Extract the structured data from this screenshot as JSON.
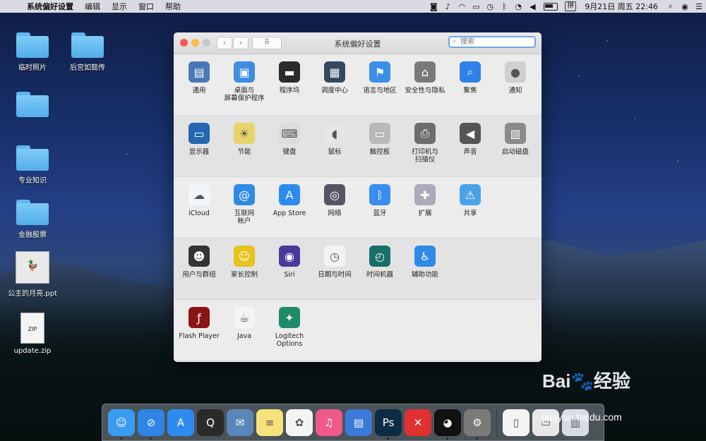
{
  "menubar": {
    "apple_icon": "apple-icon",
    "items": [
      "系统偏好设置",
      "编辑",
      "显示",
      "窗口",
      "帮助"
    ],
    "status_icons": [
      "stop-icon",
      "bell-icon",
      "airdrop-icon",
      "display-icon",
      "timemachine-icon",
      "bluetooth-icon",
      "wifi-icon",
      "volume-icon"
    ],
    "ime": "拼",
    "clock": "9月21日 周五 22:46"
  },
  "desktop": {
    "items": [
      {
        "label": "临时照片",
        "type": "folder"
      },
      {
        "label": "后宫如懿传",
        "type": "folder"
      },
      {
        "label": "",
        "type": "folder"
      },
      {
        "label": "专业知识",
        "type": "folder"
      },
      {
        "label": "金融股票",
        "type": "folder"
      },
      {
        "label": "公主的月亮.ppt",
        "type": "ppt"
      },
      {
        "label": "update.zip",
        "type": "zip",
        "badge": "ZIP"
      }
    ]
  },
  "window": {
    "title": "系统偏好设置",
    "search_placeholder": "搜索",
    "grid_glyph": "⠿",
    "back_glyph": "‹",
    "forward_glyph": "›",
    "sections": [
      [
        {
          "label": "通用",
          "icon": "general-icon",
          "color": "#4a78b4"
        },
        {
          "label": "桌面与\n屏幕保护程序",
          "icon": "desktop-icon",
          "color": "#3f8de0"
        },
        {
          "label": "程序坞",
          "icon": "dock-icon",
          "color": "#2b2b2b"
        },
        {
          "label": "调度中心",
          "icon": "mission-control-icon",
          "color": "#34495e"
        },
        {
          "label": "语言与地区",
          "icon": "language-icon",
          "color": "#3c8fe8"
        },
        {
          "label": "安全性与隐私",
          "icon": "security-icon",
          "color": "#7a7a7a"
        },
        {
          "label": "聚焦",
          "icon": "spotlight-icon",
          "color": "#2f80e8"
        },
        {
          "label": "通知",
          "icon": "notifications-icon",
          "color": "#cfcfcf"
        }
      ],
      [
        {
          "label": "显示器",
          "icon": "display-icon",
          "color": "#2466b0"
        },
        {
          "label": "节能",
          "icon": "energy-saver-icon",
          "color": "#e8d36a"
        },
        {
          "label": "键盘",
          "icon": "keyboard-icon",
          "color": "#dcdcdc"
        },
        {
          "label": "鼠标",
          "icon": "mouse-icon",
          "color": "#e6e6e6"
        },
        {
          "label": "触控板",
          "icon": "trackpad-icon",
          "color": "#b9b9b9"
        },
        {
          "label": "打印机与\n扫描仪",
          "icon": "printer-icon",
          "color": "#6d6d6d"
        },
        {
          "label": "声音",
          "icon": "sound-icon",
          "color": "#555555"
        },
        {
          "label": "启动磁盘",
          "icon": "startup-disk-icon",
          "color": "#8a8a8a"
        }
      ],
      [
        {
          "label": "iCloud",
          "icon": "icloud-icon",
          "color": "#f2f6fb"
        },
        {
          "label": "互联网\n帐户",
          "icon": "internet-accounts-icon",
          "color": "#2f8ae6"
        },
        {
          "label": "App Store",
          "icon": "app-store-icon",
          "color": "#2d8bf0"
        },
        {
          "label": "网络",
          "icon": "network-icon",
          "color": "#556"
        },
        {
          "label": "蓝牙",
          "icon": "bluetooth-icon",
          "color": "#3a8df0"
        },
        {
          "label": "扩展",
          "icon": "extensions-icon",
          "color": "#aab"
        },
        {
          "label": "共享",
          "icon": "sharing-icon",
          "color": "#4aa3e8"
        }
      ],
      [
        {
          "label": "用户与群组",
          "icon": "users-groups-icon",
          "color": "#333"
        },
        {
          "label": "家长控制",
          "icon": "parental-controls-icon",
          "color": "#e8c21d"
        },
        {
          "label": "Siri",
          "icon": "siri-icon",
          "color": "#4a3a9a"
        },
        {
          "label": "日期与时间",
          "icon": "date-time-icon",
          "color": "#f3f3f3"
        },
        {
          "label": "时间机器",
          "icon": "time-machine-icon",
          "color": "#1a6e6a"
        },
        {
          "label": "辅助功能",
          "icon": "accessibility-icon",
          "color": "#2f8ae6"
        }
      ],
      [
        {
          "label": "Flash Player",
          "icon": "flash-player-icon",
          "color": "#8a1414"
        },
        {
          "label": "Java",
          "icon": "java-icon",
          "color": "#f4f4f4"
        },
        {
          "label": "Logitech Options",
          "icon": "logitech-options-icon",
          "color": "#1e8a6a"
        }
      ]
    ]
  },
  "dock": {
    "apps": [
      {
        "icon": "finder-icon",
        "color": "#3a9cf0",
        "running": true
      },
      {
        "icon": "safari-icon",
        "color": "#2f84e6",
        "running": true
      },
      {
        "icon": "app-store-icon",
        "color": "#2d8bf0",
        "running": false
      },
      {
        "icon": "quicktime-icon",
        "color": "#2a2a2a",
        "running": false
      },
      {
        "icon": "preview-icon",
        "color": "#5a86b8",
        "running": false
      },
      {
        "icon": "notes-icon",
        "color": "#f5e27a",
        "running": false
      },
      {
        "icon": "photos-icon",
        "color": "#f4f4f4",
        "running": false
      },
      {
        "icon": "itunes-icon",
        "color": "#f05a8a",
        "running": false
      },
      {
        "icon": "keynote-icon",
        "color": "#3a7ad8",
        "running": false
      },
      {
        "icon": "photoshop-icon",
        "color": "#0c2b45",
        "running": true
      },
      {
        "icon": "xmind-icon",
        "color": "#e03030",
        "running": false
      },
      {
        "icon": "qq-icon",
        "color": "#111111",
        "running": true
      },
      {
        "icon": "system-preferences-icon",
        "color": "#7a7a7a",
        "running": true
      },
      {
        "icon": "document-icon",
        "color": "#f4f4f4",
        "running": false
      },
      {
        "icon": "downloads-stack-icon",
        "color": "#e8e8e8",
        "running": false
      },
      {
        "icon": "trash-icon",
        "color": "#d8dde4",
        "running": false
      }
    ],
    "glyphs": {
      "finder-icon": "☺",
      "safari-icon": "⊘",
      "app-store-icon": "A",
      "quicktime-icon": "Q",
      "preview-icon": "✉",
      "notes-icon": "≡",
      "photos-icon": "✿",
      "itunes-icon": "♫",
      "keynote-icon": "▤",
      "photoshop-icon": "Ps",
      "xmind-icon": "✕",
      "qq-icon": "◕",
      "system-preferences-icon": "⚙",
      "document-icon": "▯",
      "downloads-stack-icon": "▭",
      "trash-icon": "▥"
    }
  },
  "watermark": {
    "brand": "Bai🐾经验",
    "url": "jingyan.baidu.com"
  }
}
